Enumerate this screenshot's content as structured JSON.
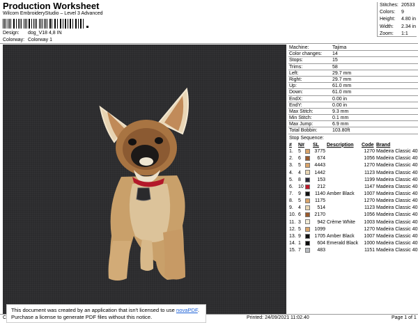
{
  "header": {
    "title": "Production Worksheet",
    "subtitle": "Wilcom EmbroideryStudio – Level 3 Advanced",
    "design_label": "Design:",
    "design_value": "dog_V18 4,8 IN",
    "colorway_label": "Colorway:",
    "colorway_value": "Colorway 1"
  },
  "stats": [
    {
      "label": "Stitches:",
      "value": "20533"
    },
    {
      "label": "Colors:",
      "value": "9"
    },
    {
      "label": "Height:",
      "value": "4.80 in"
    },
    {
      "label": "Width:",
      "value": "2.34 in"
    },
    {
      "label": "Zoom:",
      "value": "1:1"
    }
  ],
  "machine_info": [
    {
      "label": "Machine:",
      "value": "Tajima"
    },
    {
      "label": "Color changes:",
      "value": "14"
    },
    {
      "label": "Stops:",
      "value": "15"
    },
    {
      "label": "Trims:",
      "value": "58"
    },
    {
      "label": "Left:",
      "value": "29.7 mm"
    },
    {
      "label": "Right:",
      "value": "29.7 mm"
    },
    {
      "label": "Up:",
      "value": "61.0 mm"
    },
    {
      "label": "Down:",
      "value": "61.0 mm"
    },
    {
      "label": "EndX:",
      "value": "0.00 in"
    },
    {
      "label": "EndY:",
      "value": "0.00 in"
    },
    {
      "label": "Max Stitch:",
      "value": "9.3 mm"
    },
    {
      "label": "Min Stitch:",
      "value": "0.1 mm"
    },
    {
      "label": "Max Jump:",
      "value": "6.9 mm"
    },
    {
      "label": "Total Bobbin:",
      "value": "103.80ft"
    }
  ],
  "stop_sequence": {
    "title": "Stop Sequence:",
    "headers": {
      "num": "#",
      "n": "N#",
      "sl": "SL",
      "desc": "Description",
      "code": "Code",
      "brand": "Brand"
    },
    "rows": [
      {
        "num": "1.",
        "n": "5",
        "color": "#d9a46a",
        "sl": "3775",
        "desc": "",
        "code": "1270",
        "brand": "Madeira Classic 40"
      },
      {
        "num": "2.",
        "n": "6",
        "color": "#9a5a2e",
        "sl": "674",
        "desc": "",
        "code": "1056",
        "brand": "Madeira Classic 40"
      },
      {
        "num": "3.",
        "n": "5",
        "color": "#d9a46a",
        "sl": "4443",
        "desc": "",
        "code": "1270",
        "brand": "Madeira Classic 40"
      },
      {
        "num": "4.",
        "n": "4",
        "color": "#e8d6b4",
        "sl": "1442",
        "desc": "",
        "code": "1123",
        "brand": "Madeira Classic 40"
      },
      {
        "num": "5.",
        "n": "8",
        "color": "#2a2a3a",
        "sl": "153",
        "desc": "",
        "code": "1199",
        "brand": "Madeira Classic 40"
      },
      {
        "num": "6.",
        "n": "10",
        "color": "#c0182a",
        "sl": "212",
        "desc": "",
        "code": "1147",
        "brand": "Madeira Classic 40"
      },
      {
        "num": "7.",
        "n": "9",
        "color": "#111111",
        "sl": "1140",
        "desc": "Amber Black",
        "code": "1007",
        "brand": "Madeira Classic 40"
      },
      {
        "num": "8.",
        "n": "5",
        "color": "#d9a46a",
        "sl": "1175",
        "desc": "",
        "code": "1270",
        "brand": "Madeira Classic 40"
      },
      {
        "num": "9.",
        "n": "4",
        "color": "#e8d6b4",
        "sl": "514",
        "desc": "",
        "code": "1123",
        "brand": "Madeira Classic 40"
      },
      {
        "num": "10.",
        "n": "6",
        "color": "#9a5a2e",
        "sl": "2170",
        "desc": "",
        "code": "1056",
        "brand": "Madeira Classic 40"
      },
      {
        "num": "11.",
        "n": "3",
        "color": "#f2ecd8",
        "sl": "942",
        "desc": "Crème White",
        "code": "1003",
        "brand": "Madeira Classic 40"
      },
      {
        "num": "12.",
        "n": "5",
        "color": "#d9a46a",
        "sl": "1099",
        "desc": "",
        "code": "1270",
        "brand": "Madeira Classic 40"
      },
      {
        "num": "13.",
        "n": "9",
        "color": "#111111",
        "sl": "1705",
        "desc": "Amber Black",
        "code": "1007",
        "brand": "Madeira Classic 40"
      },
      {
        "num": "14.",
        "n": "1",
        "color": "#0a0a0a",
        "sl": "604",
        "desc": "Emerald Black",
        "code": "1000",
        "brand": "Madeira Classic 40"
      },
      {
        "num": "15.",
        "n": "7",
        "color": "#b9bcc0",
        "sl": "483",
        "desc": "",
        "code": "1151",
        "brand": "Madeira Classic 40"
      }
    ]
  },
  "footer": {
    "left": "Cr",
    "printed": "Printed: 24/09/2021 11:02.40",
    "page": "Page 1 of 1"
  },
  "banner": {
    "line1_prefix": "This document was created by an application that isn't licensed to use ",
    "link": "novaPDF",
    "line1_suffix": ".",
    "line2": "Purchase a license to generate PDF files without this notice."
  }
}
